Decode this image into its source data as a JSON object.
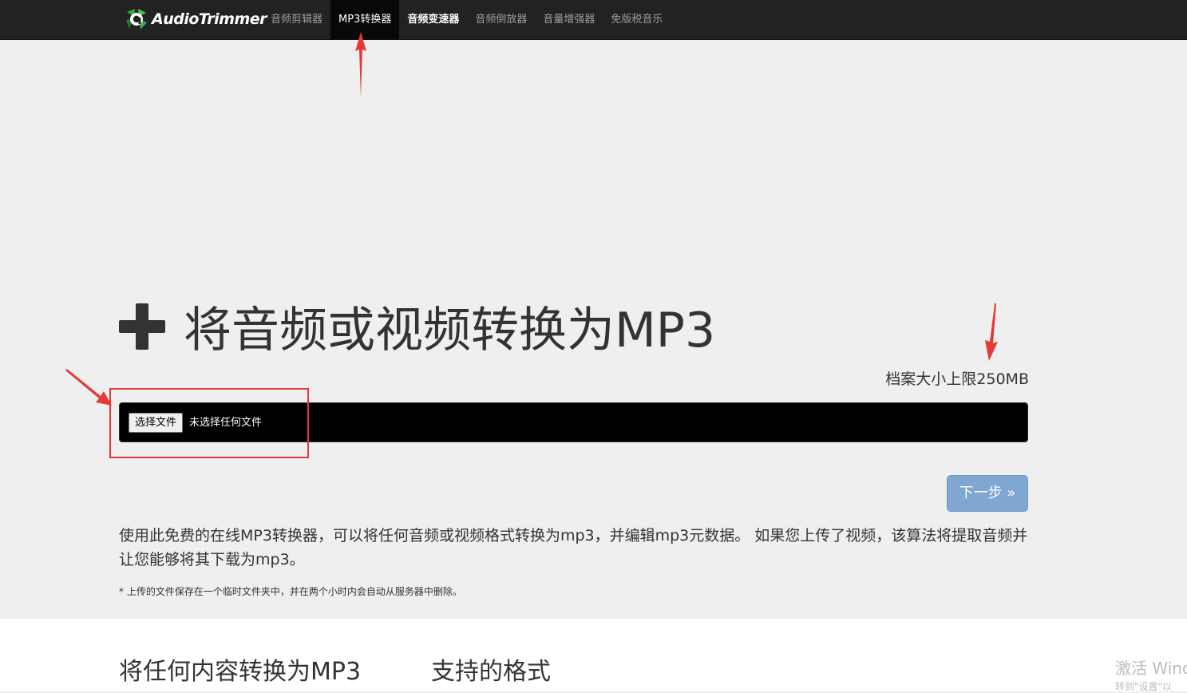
{
  "navbar": {
    "brand": "AudioTrimmer",
    "items": [
      {
        "label": "音频剪辑器",
        "state": "normal"
      },
      {
        "label": "MP3转换器",
        "state": "active"
      },
      {
        "label": "音频变速器",
        "state": "bold"
      },
      {
        "label": "音频倒放器",
        "state": "normal"
      },
      {
        "label": "音量增强器",
        "state": "normal"
      },
      {
        "label": "免版税音乐",
        "state": "normal"
      }
    ]
  },
  "hero": {
    "title": "将音频或视频转换为MP3",
    "size_limit": "档案大小上限250MB",
    "file_input": {
      "button_label": "选择文件",
      "status": "未选择任何文件"
    },
    "next_button": "下一步 »",
    "description": "使用此免费的在线MP3转换器，可以将任何音频或视频格式转换为mp3，并编辑mp3元数据。 如果您上传了视频，该算法将提取音频并让您能够将其下载为mp3。",
    "footnote": "* 上传的文件保存在一个临时文件夹中，并在两个小时内会自动从服务器中删除。"
  },
  "lower": {
    "section1_title": "将任何内容转换为MP3",
    "section2_title": "支持的格式"
  },
  "watermark": {
    "line1": "激活 Winc",
    "line2": "转到\"设置\"以"
  },
  "colors": {
    "navbar_bg": "#222222",
    "nav_active_bg": "#080808",
    "next_button_bg": "#7fa7d1",
    "annotation": "#e03a3a"
  }
}
